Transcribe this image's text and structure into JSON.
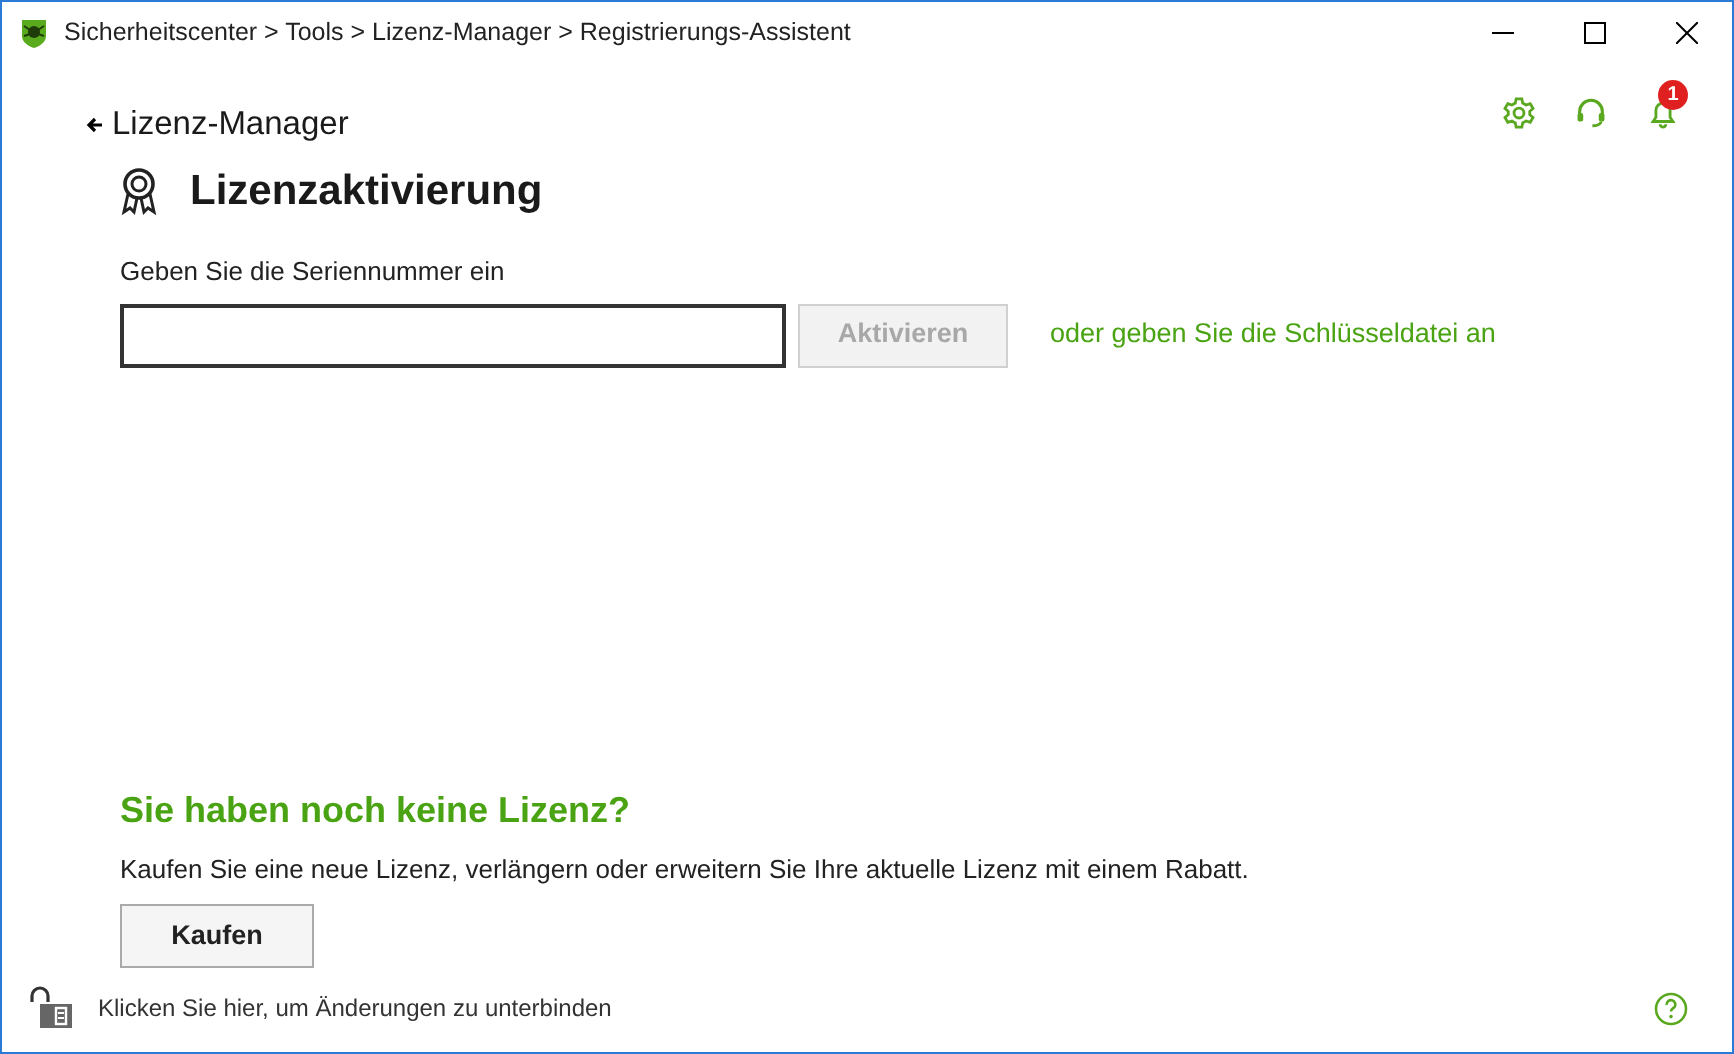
{
  "window": {
    "title": "Sicherheitscenter > Tools > Lizenz-Manager > Registrierungs-Assistent"
  },
  "back_link": {
    "label": "Lizenz-Manager"
  },
  "notifications": {
    "count": "1"
  },
  "heading": "Lizenzaktivierung",
  "serial": {
    "label": "Geben Sie die Seriennummer ein",
    "activate_button": {
      "label": "Aktivieren",
      "disabled": true
    },
    "key_file_link": "oder geben Sie die Schlüsseldatei an"
  },
  "no_license": {
    "heading": "Sie haben noch keine Lizenz?",
    "text": "Kaufen Sie eine neue Lizenz, verlängern oder erweitern Sie Ihre aktuelle Lizenz mit einem Rabatt.",
    "buy_button": "Kaufen"
  },
  "footer": {
    "lock_text": "Klicken Sie hier, um Änderungen zu unterbinden"
  }
}
